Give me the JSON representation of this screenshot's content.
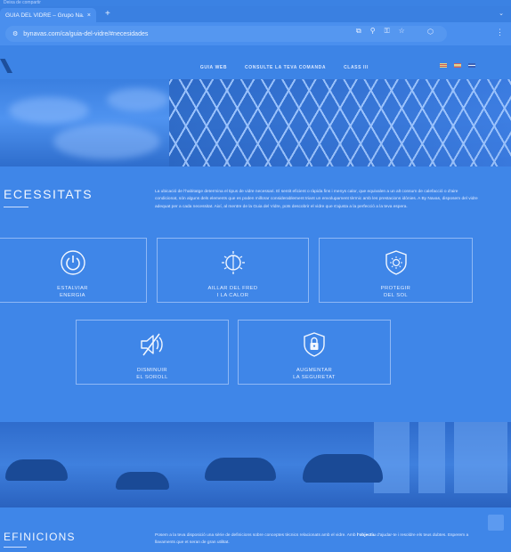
{
  "browser": {
    "notice": "Deixa de compartir",
    "tab_title": "GUIA DEL VIDRE – Grupo Na...",
    "tab_close": "×",
    "new_tab": "+",
    "tab_menu": "⌄",
    "url": "bynavas.com/ca/guia-del-vidre/#necesidades",
    "site_info_icon": "tune-icon",
    "menu": "⋮"
  },
  "site": {
    "nav": [
      {
        "label": "GUIA WEB"
      },
      {
        "label": "CONSULTE LA TEVA COMANDA"
      },
      {
        "label": "CLASS III"
      }
    ]
  },
  "necessitats": {
    "title": "ECESSITATS",
    "intro": "La ubicació de l'habitatge determina el tipus de vidre necessari. El sentit eficient o ràpida fins i menys calor, que equivalen a un alt consum de calefacció o d'aire condicionat, són alguns dels elements que es poden millorar considerablement triant un envolupament tèrmic amb les prestacions idònies. A By Navas, disposem del vidre adequat per a cada necessitat. Així, al mentre de la Guia del Vidre, pots descobrir el vidre que s'ajusta a la perfecció a la teva espera.",
    "cards": [
      {
        "label": "ESTALVIAR\nENERGIA",
        "icon": "power-icon"
      },
      {
        "label": "AILLAR DEL FRED\nI LA CALOR",
        "icon": "sun-snowflake-icon"
      },
      {
        "label": "PROTEGIR\nDEL SOL",
        "icon": "sun-shield-icon"
      },
      {
        "label": "DISMINUIR\nEL SOROLL",
        "icon": "muted-speaker-icon"
      },
      {
        "label": "AUGMENTAR\nLA SEGURETAT",
        "icon": "lock-shield-icon"
      }
    ]
  },
  "definicions": {
    "title": "EFINICIONS",
    "text_before": "Posem a la teva disposició una sèrie de definicions sobre conceptes tècnics relacionats amb el vidre. Amb ",
    "text_bold": "l'objectiu",
    "text_after": " d'ajudar-te i resoldre els teus dubtes. Esperem a llavaments que et seran de gran utilitat."
  },
  "colors": {
    "overlay": "#3f86e8",
    "card_border": "#8fb8f5"
  }
}
